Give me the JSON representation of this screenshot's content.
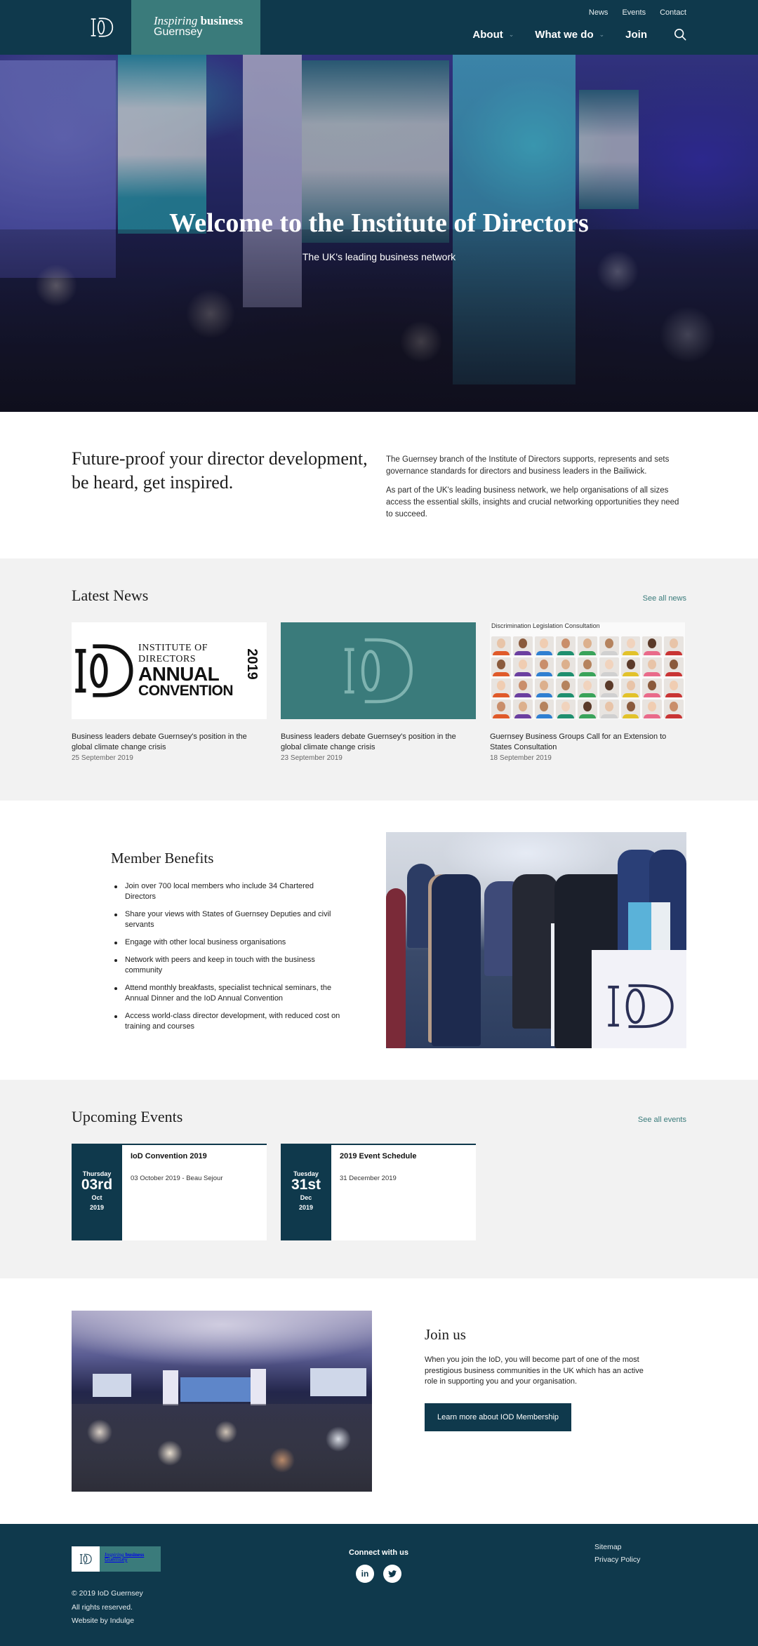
{
  "brand": {
    "tagline_italic": "Inspiring",
    "tagline_bold": "business",
    "tagline_line2": "Guernsey",
    "colors": {
      "navy": "#0f394c",
      "teal": "#3a7b7b",
      "grey_bg": "#f2f2f2"
    }
  },
  "header": {
    "utility_nav": [
      "News",
      "Events",
      "Contact"
    ],
    "main_nav": [
      {
        "label": "About",
        "has_dropdown": true
      },
      {
        "label": "What we do",
        "has_dropdown": true
      },
      {
        "label": "Join",
        "has_dropdown": false
      }
    ],
    "search_icon": "search-icon"
  },
  "hero": {
    "title": "Welcome to the Institute of Directors",
    "subtitle": "The UK's leading business network"
  },
  "intro": {
    "heading": "Future-proof your director development, be heard, get inspired.",
    "paragraphs": [
      "The Guernsey branch of the Institute of Directors supports, represents and sets governance standards for directors and business leaders in the Bailiwick.",
      "As part of the UK's leading business network, we help organisations of all sizes access the essential skills, insights and crucial networking opportunities they need to succeed."
    ]
  },
  "news": {
    "heading": "Latest News",
    "see_all": "See all news",
    "items": [
      {
        "title": "Business leaders debate Guernsey's position in the global climate change crisis",
        "date": "25 September 2019",
        "thumb": {
          "line1": "INSTITUTE OF DIRECTORS",
          "line2": "ANNUAL",
          "line3": "CONVENTION",
          "year": "2019"
        }
      },
      {
        "title": "Business leaders debate Guernsey's position in the global climate change crisis",
        "date": "23 September 2019"
      },
      {
        "title": "Guernsey Business Groups Call for an Extension to States Consultation",
        "date": "18 September 2019",
        "thumb": {
          "caption": "Discrimination Legislation Consultation"
        }
      }
    ]
  },
  "benefits": {
    "heading": "Member Benefits",
    "items": [
      "Join over 700 local members who include 34 Chartered Directors",
      "Share your views with States of Guernsey Deputies and civil servants",
      "Engage with other local business organisations",
      "Network with peers and keep in touch with the business community",
      "Attend monthly breakfasts, specialist technical seminars, the Annual Dinner and the IoD Annual Convention",
      "Access world-class director development, with reduced cost on training and courses"
    ]
  },
  "events": {
    "heading": "Upcoming Events",
    "see_all": "See all events",
    "items": [
      {
        "weekday": "Thursday",
        "day": "03rd",
        "month": "Oct",
        "year": "2019",
        "title": "IoD Convention 2019",
        "meta": "03 October 2019 - Beau Sejour"
      },
      {
        "weekday": "Tuesday",
        "day": "31st",
        "month": "Dec",
        "year": "2019",
        "title": "2019 Event Schedule",
        "meta": "31 December 2019"
      }
    ]
  },
  "join": {
    "heading": "Join us",
    "body": "When you join the IoD, you will become part of one of the most prestigious business communities in the UK which has an active role in supporting you and your organisation.",
    "cta": "Learn more about IOD Membership"
  },
  "footer": {
    "copyright": "© 2019 IoD Guernsey",
    "rights": "All rights reserved.",
    "credit": "Website by Indulge",
    "connect_label": "Connect with us",
    "social": [
      {
        "name": "linkedin",
        "glyph": "in"
      },
      {
        "name": "twitter",
        "glyph": "t"
      }
    ],
    "links": [
      "Sitemap",
      "Privacy Policy"
    ]
  }
}
